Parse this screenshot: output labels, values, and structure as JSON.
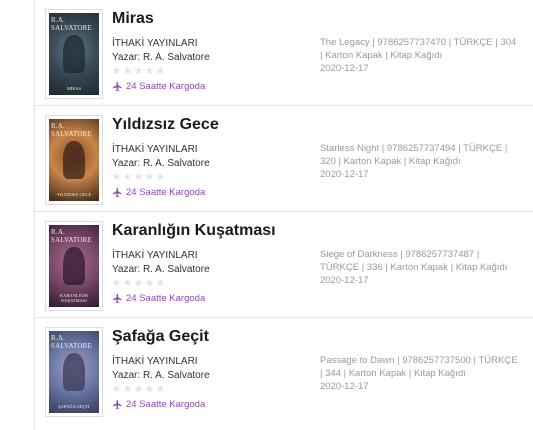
{
  "products": [
    {
      "title": "Miras",
      "publisher": "İTHAKİ YAYINLARI",
      "author": "Yazar: R. A. Salvatore",
      "rating": 0,
      "shipping": "24 Saatte Kargoda",
      "details": "The Legacy | 9786257737470 | TÜRKÇE | 304 | Karton Kapak | Kitap Kağıdı",
      "date": "2020-12-17",
      "cover": {
        "brand": "R.A. SALVATORE",
        "title": "MİRAS",
        "colors": [
          "#3a4a58",
          "#5c7f86",
          "#1d2830"
        ]
      }
    },
    {
      "title": "Yıldızsız Gece",
      "publisher": "İTHAKİ YAYINLARI",
      "author": "Yazar: R. A. Salvatore",
      "rating": 0,
      "shipping": "24 Saatte Kargoda",
      "details": "Starless Night | 9786257737494 | TÜRKÇE | 320 | Karton Kapak | Kitap Kağıdı",
      "date": "2020-12-17",
      "cover": {
        "brand": "R.A. SALVATORE",
        "title": "YILDIZSIZ GECE",
        "colors": [
          "#c8864a",
          "#8a4a2a",
          "#3a2418"
        ]
      }
    },
    {
      "title": "Karanlığın Kuşatması",
      "publisher": "İTHAKİ YAYINLARI",
      "author": "Yazar: R. A. Salvatore",
      "rating": 0,
      "shipping": "24 Saatte Kargoda",
      "details": "Siege of Darkness | 9786257737487 | TÜRKÇE | 336 | Karton Kapak | Kitap Kağıdı",
      "date": "2020-12-17",
      "cover": {
        "brand": "R.A. SALVATORE",
        "title": "KARANLIĞIN KUŞATMASI",
        "colors": [
          "#7a4a6a",
          "#b06a8a",
          "#2e1a30"
        ]
      }
    },
    {
      "title": "Şafağa Geçit",
      "publisher": "İTHAKİ YAYINLARI",
      "author": "Yazar: R. A. Salvatore",
      "rating": 0,
      "shipping": "24 Saatte Kargoda",
      "details": "Passage to Dawn | 9786257737500 | TÜRKÇE | 344 | Karton Kapak | Kitap Kağıdı",
      "date": "2020-12-17",
      "cover": {
        "brand": "R.A. SALVATORE",
        "title": "ŞAFAĞA GEÇİT",
        "colors": [
          "#6a7aa8",
          "#b09ab8",
          "#3a3a5a"
        ]
      }
    }
  ],
  "colors": {
    "accent": "#8b4ab8",
    "star_empty": "#e2e2e2",
    "meta_text": "#9a9a9a"
  },
  "icons": {
    "shipping": "airplane-icon",
    "rating": "star-icon"
  }
}
